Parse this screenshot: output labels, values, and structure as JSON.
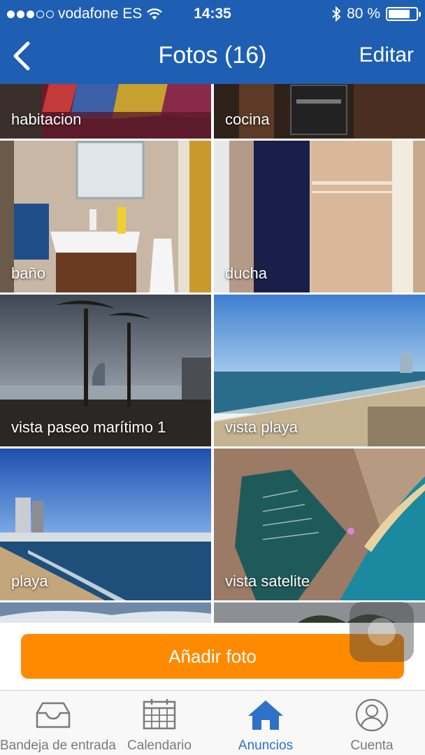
{
  "status": {
    "carrier": "vodafone ES",
    "time": "14:35",
    "battery": "80 %",
    "battery_level": 0.8,
    "signal_bars": 3
  },
  "nav": {
    "title": "Fotos (16)",
    "edit_label": "Editar",
    "back_icon": "chevron-left-icon"
  },
  "photos": [
    {
      "label": "habitacion"
    },
    {
      "label": "cocina"
    },
    {
      "label": "baño"
    },
    {
      "label": "ducha"
    },
    {
      "label": "vista paseo marítimo 1"
    },
    {
      "label": "vista playa"
    },
    {
      "label": "playa"
    },
    {
      "label": "vista satelite"
    }
  ],
  "add_button": {
    "label": "Añadir foto",
    "color": "#ff8a00"
  },
  "tabs": [
    {
      "label": "Bandeja de entrada",
      "icon": "inbox-icon"
    },
    {
      "label": "Calendario",
      "icon": "calendar-icon"
    },
    {
      "label": "Anuncios",
      "icon": "home-icon",
      "active": true
    },
    {
      "label": "Cuenta",
      "icon": "user-icon"
    }
  ],
  "colors": {
    "header": "#1e5fb4",
    "active_tab": "#2e72c8",
    "inactive_tab": "#7a7a7a"
  }
}
